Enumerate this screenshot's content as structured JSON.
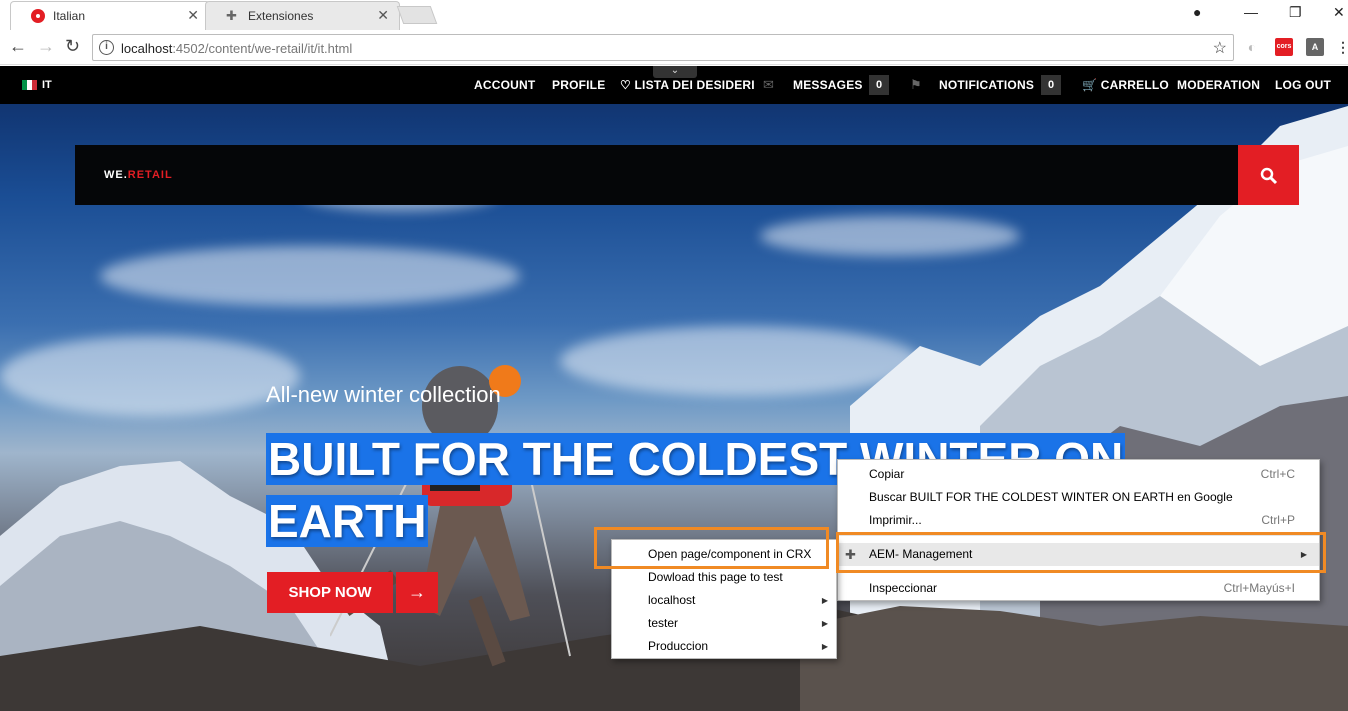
{
  "browser": {
    "tabs": [
      {
        "title": "Italian",
        "active": true
      },
      {
        "title": "Extensiones",
        "active": false
      }
    ],
    "address": {
      "host": "localhost",
      "rest": ":4502/content/we-retail/it/it.html"
    },
    "extensions": [
      "cors",
      "A"
    ]
  },
  "site": {
    "lang": "IT",
    "nav": {
      "account": "ACCOUNT",
      "profile": "PROFILE",
      "wishlist": "LISTA DEI DESIDERI",
      "messages": "MESSAGES",
      "messages_count": "0",
      "notifications": "NOTIFICATIONS",
      "notifications_count": "0",
      "cart": "CARRELLO",
      "moderation": "MODERATION",
      "logout": "LOG OUT"
    },
    "logo": {
      "part1": "WE.",
      "part2": "RETAIL"
    },
    "hero": {
      "subtitle": "All-new winter collection",
      "title_line1": "BUILT FOR THE COLDEST WINTER ON",
      "title_line2": "EARTH",
      "cta": "SHOP NOW",
      "cta_arrow": "→"
    }
  },
  "context_menu": {
    "items": [
      {
        "label": "Copiar",
        "shortcut": "Ctrl+C"
      },
      {
        "label": "Buscar BUILT FOR THE COLDEST WINTER ON EARTH en Google",
        "shortcut": ""
      },
      {
        "label": "Imprimir...",
        "shortcut": "Ctrl+P"
      },
      {
        "label": "AEM- Management",
        "shortcut": "",
        "submenu": true
      },
      {
        "label": "Inspeccionar",
        "shortcut": "Ctrl+Mayús+I"
      }
    ]
  },
  "submenu": {
    "items": [
      {
        "label": "Open page/component in CRX"
      },
      {
        "label": "Dowload this page to test"
      },
      {
        "label": "localhost",
        "submenu": true
      },
      {
        "label": "tester",
        "submenu": true
      },
      {
        "label": "Produccion",
        "submenu": true
      }
    ]
  },
  "colors": {
    "brand_red": "#e31e24",
    "highlight": "#f08a24",
    "selection": "#1a73e8"
  }
}
